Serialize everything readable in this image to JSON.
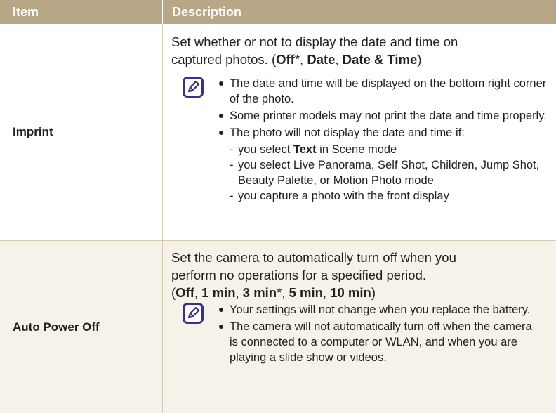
{
  "header": {
    "item": "Item",
    "description": "Description"
  },
  "rows": [
    {
      "item": "Imprint",
      "desc_line1": "Set whether or not to display the date and time on",
      "desc_line2_pre": "captured photos. (",
      "opt1": "Off",
      "opt1_suffix": "*, ",
      "opt2": "Date",
      "opt2_suffix": ", ",
      "opt3": "Date & Time",
      "desc_close": ")",
      "bullets": {
        "b1": "The date and time will be displayed on the bottom right corner of the photo.",
        "b2": "Some printer models may not print the date and time properly.",
        "b3": "The photo will not display the date and time if:",
        "sub1_pre": "you select ",
        "sub1_bold": "Text",
        "sub1_post": " in Scene mode",
        "sub2": "you select Live Panorama, Self Shot, Children, Jump Shot, Beauty Palette, or Motion Photo mode",
        "sub3": "you capture a photo with the front display"
      }
    },
    {
      "item": "Auto Power Off",
      "desc_line1": "Set the camera to automatically turn off when you",
      "desc_line2": "perform no operations for a specified period.",
      "paren_open": "(",
      "opt1": "Off",
      "sep1": ", ",
      "opt2": "1 min",
      "sep2": ", ",
      "opt3": "3 min",
      "opt3_suffix": "*, ",
      "opt4": "5 min",
      "sep4": ", ",
      "opt5": "10 min",
      "paren_close": ")",
      "bullets": {
        "b1": "Your settings will not change when you replace the battery.",
        "b2": "The camera will not automatically turn off when the camera is connected to a computer or WLAN, and when you are playing a slide show or videos."
      }
    }
  ],
  "icons": {
    "note": "note-pencil-icon"
  },
  "colors": {
    "header_bg": "#b8a786",
    "icon": "#3b2f86",
    "row_alt_bg": "#f5f2ea"
  }
}
